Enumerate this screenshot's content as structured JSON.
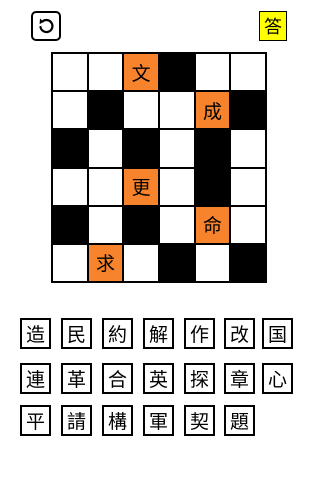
{
  "toolbar": {
    "undo_icon": "undo-icon",
    "answer_label": "答",
    "answer_color": "#ffff00"
  },
  "board": {
    "rows": 6,
    "cols": 6,
    "highlight_color": "#f7842c",
    "cells": [
      [
        {
          "s": "w",
          "t": ""
        },
        {
          "s": "w",
          "t": ""
        },
        {
          "s": "o",
          "t": "文"
        },
        {
          "s": "b",
          "t": ""
        },
        {
          "s": "w",
          "t": ""
        },
        {
          "s": "w",
          "t": ""
        }
      ],
      [
        {
          "s": "w",
          "t": ""
        },
        {
          "s": "b",
          "t": ""
        },
        {
          "s": "w",
          "t": ""
        },
        {
          "s": "w",
          "t": ""
        },
        {
          "s": "o",
          "t": "成"
        },
        {
          "s": "b",
          "t": ""
        }
      ],
      [
        {
          "s": "b",
          "t": ""
        },
        {
          "s": "w",
          "t": ""
        },
        {
          "s": "b",
          "t": ""
        },
        {
          "s": "w",
          "t": ""
        },
        {
          "s": "b",
          "t": ""
        },
        {
          "s": "w",
          "t": ""
        }
      ],
      [
        {
          "s": "w",
          "t": ""
        },
        {
          "s": "w",
          "t": ""
        },
        {
          "s": "o",
          "t": "更"
        },
        {
          "s": "w",
          "t": ""
        },
        {
          "s": "b",
          "t": ""
        },
        {
          "s": "w",
          "t": ""
        }
      ],
      [
        {
          "s": "b",
          "t": ""
        },
        {
          "s": "w",
          "t": ""
        },
        {
          "s": "b",
          "t": ""
        },
        {
          "s": "w",
          "t": ""
        },
        {
          "s": "o",
          "t": "命"
        },
        {
          "s": "w",
          "t": ""
        }
      ],
      [
        {
          "s": "w",
          "t": ""
        },
        {
          "s": "o",
          "t": "求"
        },
        {
          "s": "w",
          "t": ""
        },
        {
          "s": "b",
          "t": ""
        },
        {
          "s": "w",
          "t": ""
        },
        {
          "s": "b",
          "t": ""
        }
      ]
    ]
  },
  "palette": {
    "rows": [
      [
        "造",
        "民",
        "約",
        "解",
        "作",
        "改",
        "国"
      ],
      [
        "連",
        "革",
        "合",
        "英",
        "探",
        "章",
        "心"
      ],
      [
        "平",
        "請",
        "構",
        "軍",
        "契",
        "題"
      ]
    ]
  }
}
